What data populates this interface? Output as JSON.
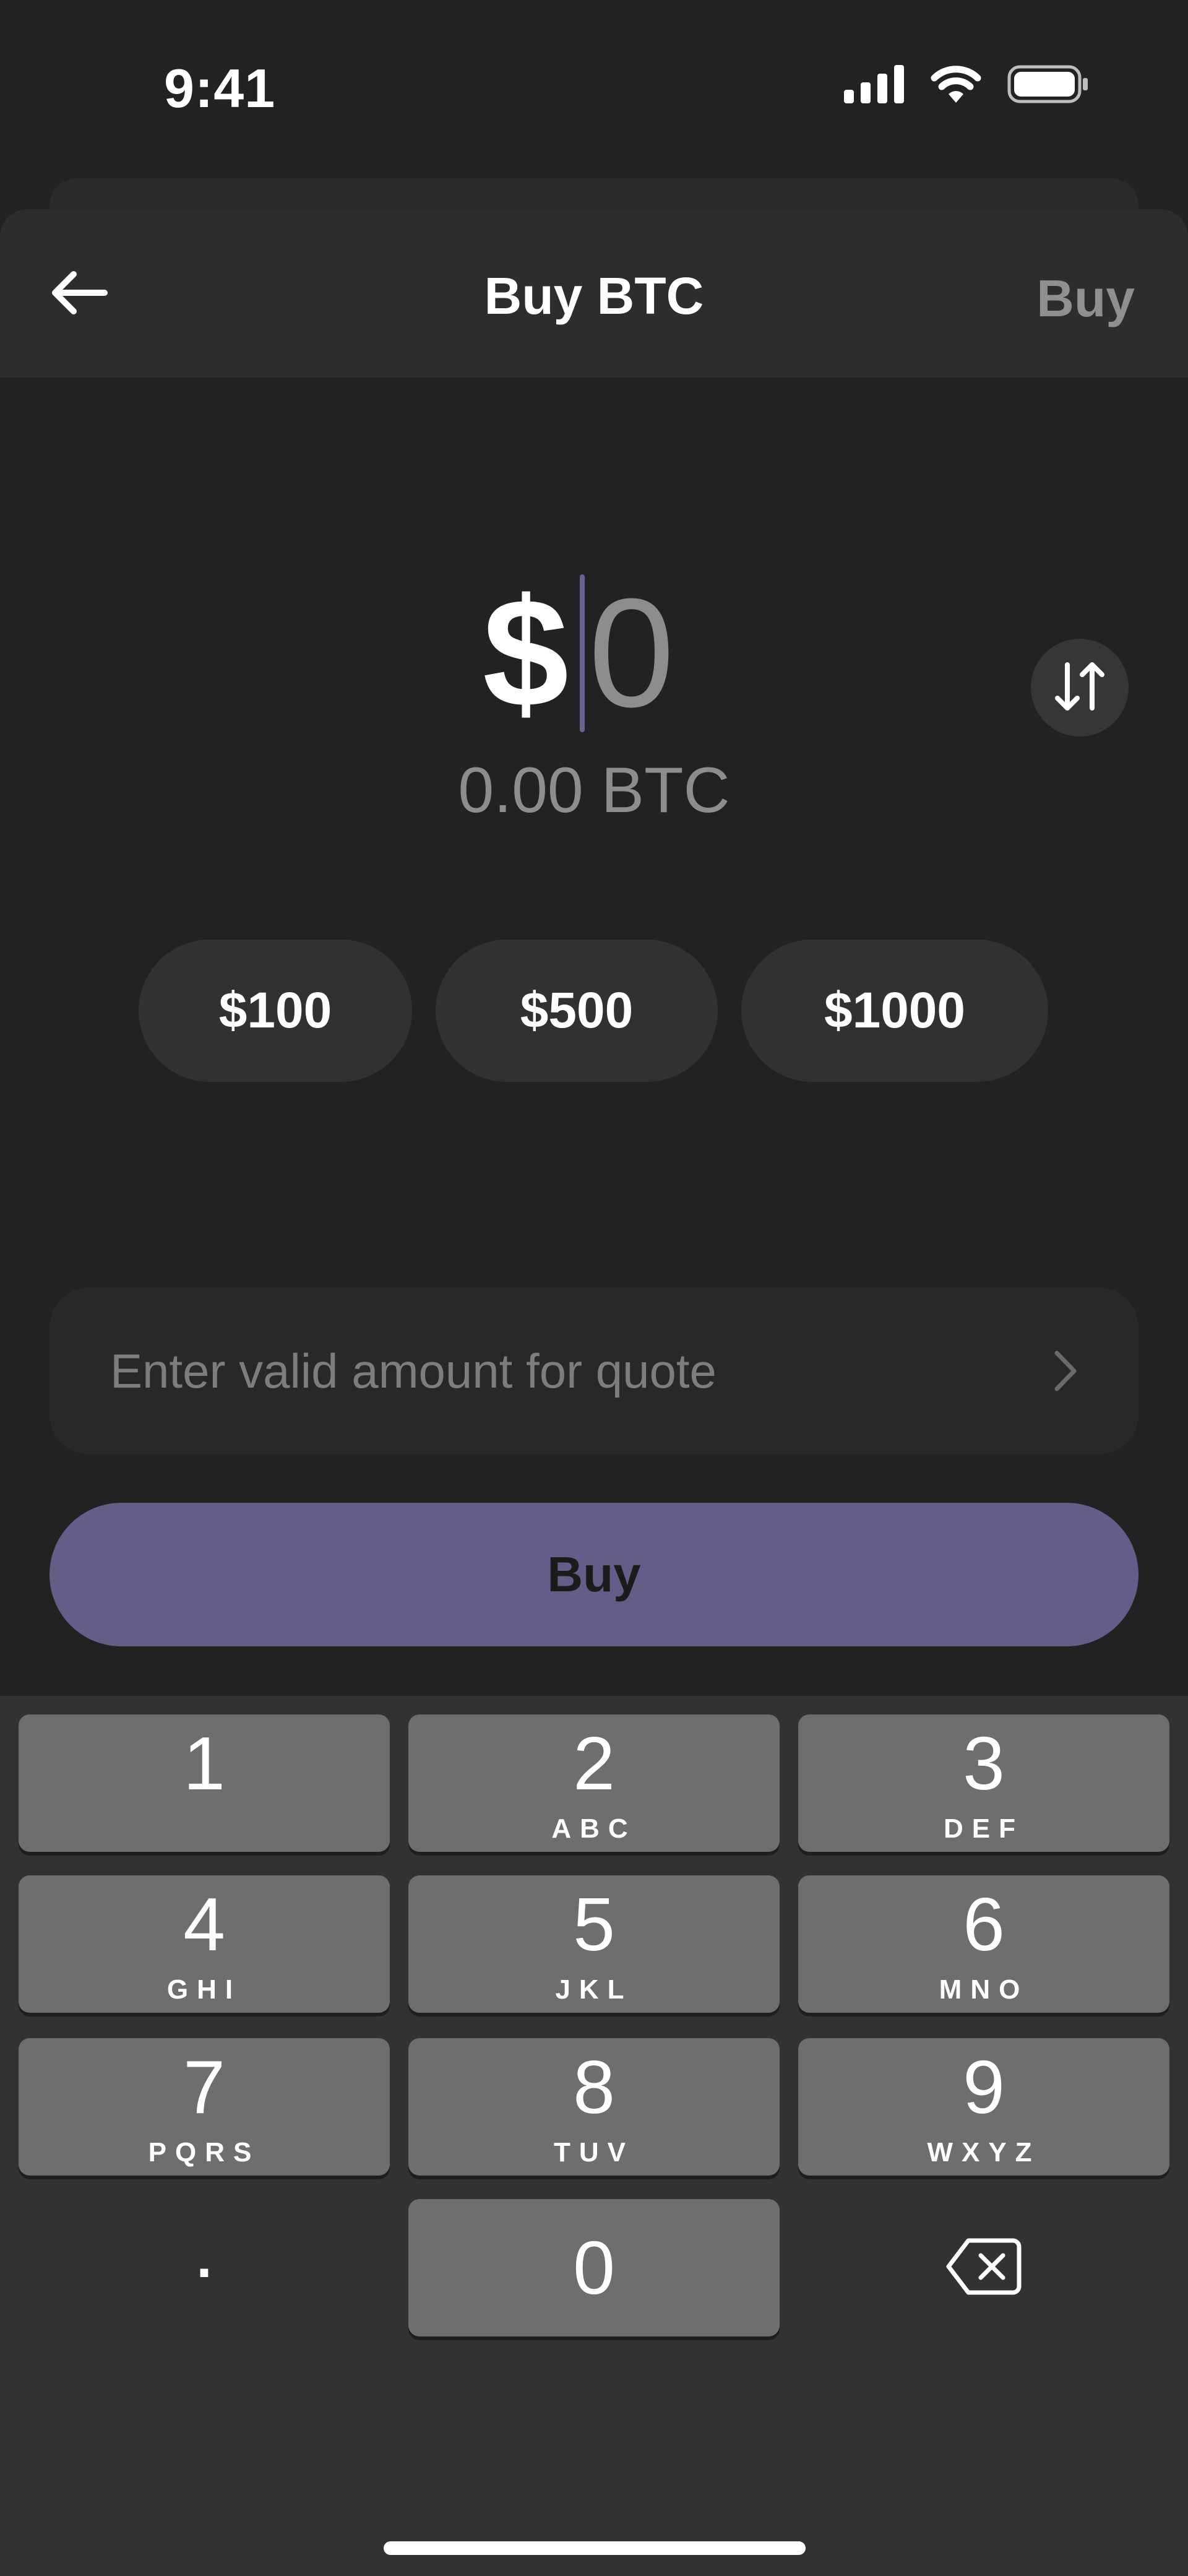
{
  "status_bar": {
    "time": "9:41",
    "icons": [
      "cellular-signal-icon",
      "wifi-icon",
      "battery-icon"
    ]
  },
  "nav": {
    "back_icon": "arrow-left-icon",
    "title": "Buy BTC",
    "action_label": "Buy"
  },
  "amount": {
    "currency_symbol": "$",
    "value": "0",
    "converted": "0.00 BTC",
    "swap_icon": "swap-vertical-icon"
  },
  "presets": [
    "$100",
    "$500",
    "$1000"
  ],
  "quote": {
    "placeholder": "Enter valid amount for quote",
    "chevron_icon": "chevron-right-icon"
  },
  "buy_button": {
    "label": "Buy"
  },
  "keypad": {
    "keys": [
      {
        "digit": "1",
        "letters": ""
      },
      {
        "digit": "2",
        "letters": "ABC"
      },
      {
        "digit": "3",
        "letters": "DEF"
      },
      {
        "digit": "4",
        "letters": "GHI"
      },
      {
        "digit": "5",
        "letters": "JKL"
      },
      {
        "digit": "6",
        "letters": "MNO"
      },
      {
        "digit": "7",
        "letters": "PQRS"
      },
      {
        "digit": "8",
        "letters": "TUV"
      },
      {
        "digit": "9",
        "letters": "WXYZ"
      },
      {
        "digit": "0",
        "letters": ""
      }
    ],
    "decimal_label": ".",
    "delete_icon": "backspace-icon"
  },
  "colors": {
    "background": "#222222",
    "accent": "#655d88",
    "caret": "#6b6294",
    "key": "#6e6e6e",
    "keypad_bg": "#323232"
  }
}
